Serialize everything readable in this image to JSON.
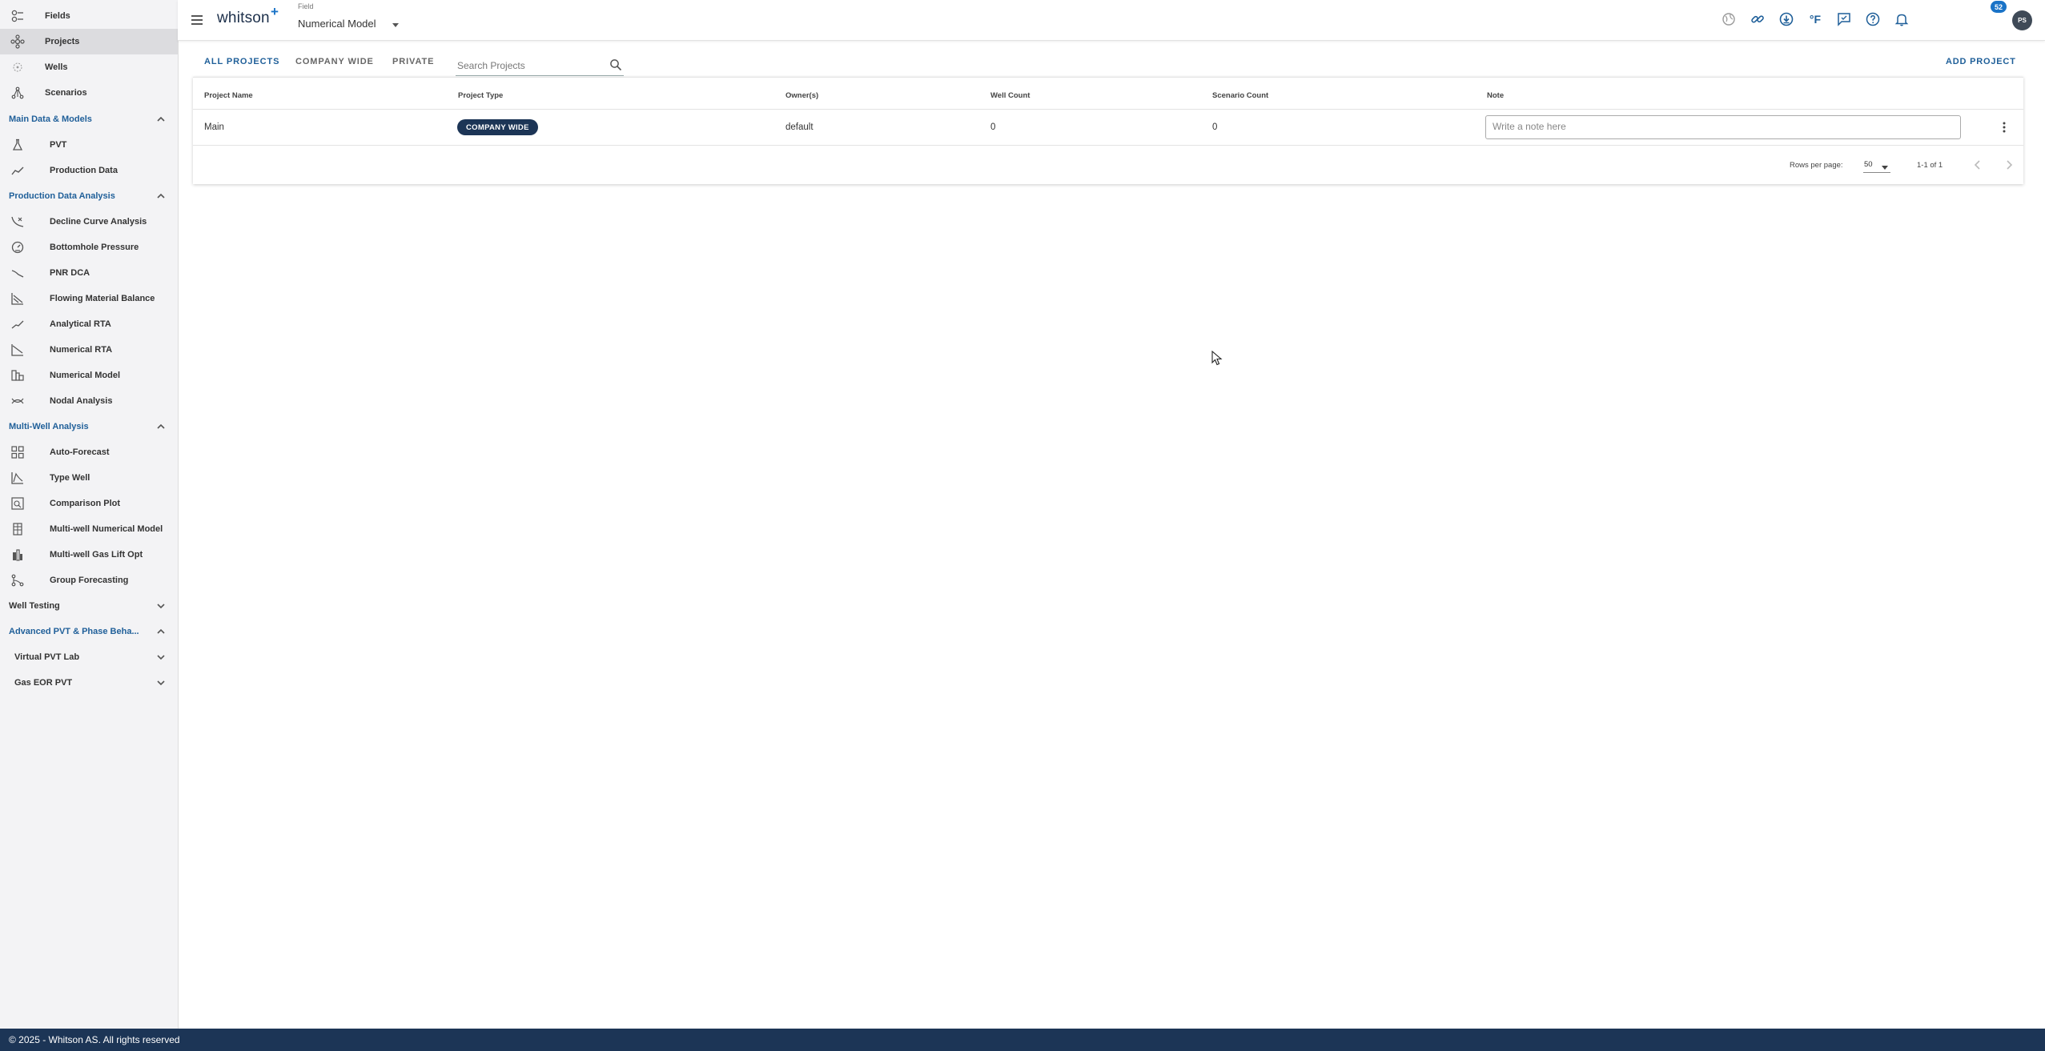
{
  "sidebar": {
    "top_items": [
      {
        "label": "Fields",
        "icon": "fields-icon"
      },
      {
        "label": "Projects",
        "icon": "projects-icon",
        "active": true
      },
      {
        "label": "Wells",
        "icon": "wells-icon"
      },
      {
        "label": "Scenarios",
        "icon": "scenarios-icon"
      }
    ],
    "sections": {
      "main_data": {
        "label": "Main Data & Models",
        "items": [
          {
            "label": "PVT",
            "icon": "flask-icon"
          },
          {
            "label": "Production Data",
            "icon": "trend-icon"
          }
        ]
      },
      "pda": {
        "label": "Production Data Analysis",
        "items": [
          {
            "label": "Decline Curve Analysis",
            "icon": "decline-icon"
          },
          {
            "label": "Bottomhole Pressure",
            "icon": "gauge-icon"
          },
          {
            "label": "PNR DCA",
            "icon": "pnr-icon"
          },
          {
            "label": "Flowing Material Balance",
            "icon": "fmb-icon"
          },
          {
            "label": "Analytical RTA",
            "icon": "rta-icon"
          },
          {
            "label": "Numerical RTA",
            "icon": "numerical-rta-icon"
          },
          {
            "label": "Numerical Model",
            "icon": "numerical-model-icon"
          },
          {
            "label": "Nodal Analysis",
            "icon": "nodal-icon"
          }
        ]
      },
      "mwa": {
        "label": "Multi-Well Analysis",
        "items": [
          {
            "label": "Auto-Forecast",
            "icon": "grid-icon"
          },
          {
            "label": "Type Well",
            "icon": "type-well-icon"
          },
          {
            "label": "Comparison Plot",
            "icon": "comparison-icon"
          },
          {
            "label": "Multi-well Numerical Model",
            "icon": "multiwell-model-icon"
          },
          {
            "label": "Multi-well Gas Lift Opt",
            "icon": "gas-lift-icon"
          },
          {
            "label": "Group Forecasting",
            "icon": "group-icon"
          }
        ]
      },
      "well_testing": {
        "label": "Well Testing"
      },
      "adv_pvt": {
        "label": "Advanced PVT & Phase Beha..."
      },
      "virtual_lab": {
        "label": "Virtual PVT Lab"
      },
      "gas_eor": {
        "label": "Gas EOR PVT"
      }
    }
  },
  "header": {
    "logo": "whitson",
    "logo_plus": "+",
    "field_caption": "Field",
    "field_value": "Numerical Model",
    "notification_count": "52",
    "avatar_initials": "PS",
    "temp_unit": "°F"
  },
  "tabs": [
    "ALL PROJECTS",
    "COMPANY WIDE",
    "PRIVATE"
  ],
  "search": {
    "placeholder": "Search Projects",
    "value": ""
  },
  "add_project_label": "ADD PROJECT",
  "table": {
    "columns": [
      "Project Name",
      "Project Type",
      "Owner(s)",
      "Well Count",
      "Scenario Count",
      "Note"
    ],
    "rows": [
      {
        "project_name": "Main",
        "project_type": "COMPANY WIDE",
        "owners": "default",
        "well_count": "0",
        "scenario_count": "0",
        "note_placeholder": "Write a note here"
      }
    ]
  },
  "pagination": {
    "rows_per_page_label": "Rows per page:",
    "rows_per_page": "50",
    "range": "1-1 of 1"
  },
  "footer": {
    "text": "© 2025 - Whitson AS. All rights reserved"
  },
  "colors": {
    "accent": "#1f5f99",
    "navy": "#1c3556",
    "badge_blue": "#1a73c7",
    "sidebar_bg": "#f3f3f5"
  }
}
